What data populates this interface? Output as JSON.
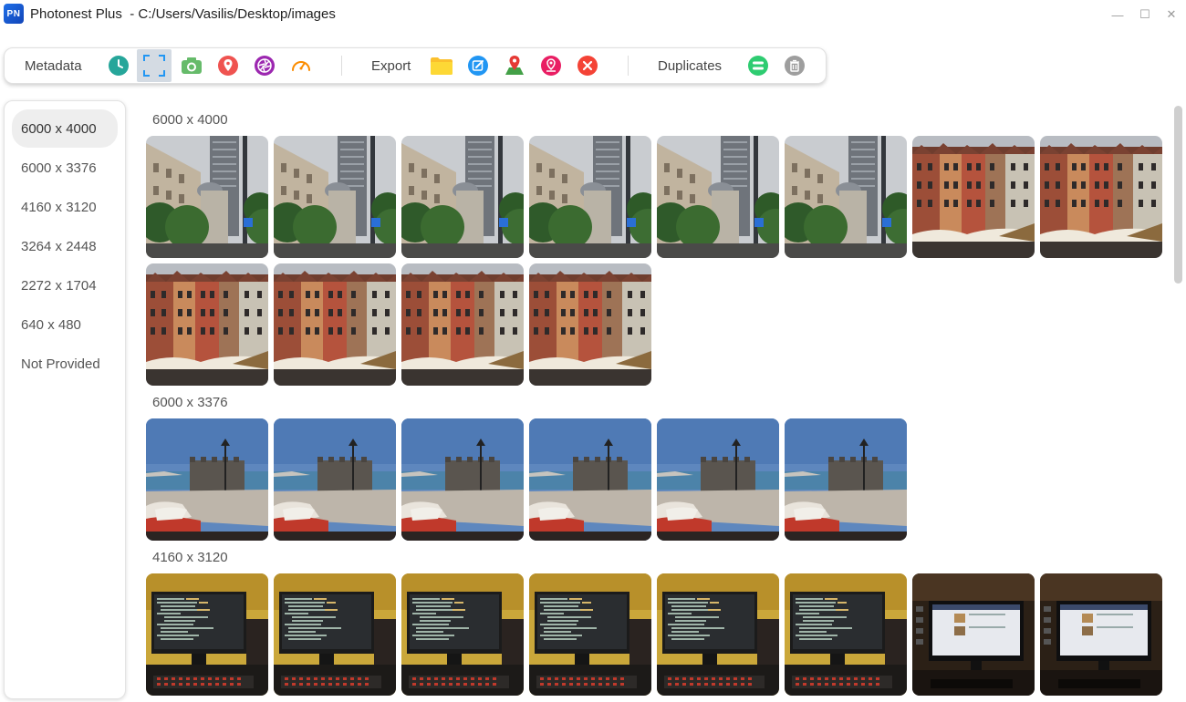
{
  "window": {
    "logo_text": "PN",
    "title": "Photonest Plus  - C:/Users/Vasilis/Desktop/images",
    "minimize": "—",
    "maximize": "☐",
    "close": "✕"
  },
  "toolbar": {
    "metadata_label": "Metadata",
    "export_label": "Export",
    "duplicates_label": "Duplicates"
  },
  "sidebar": {
    "items": [
      {
        "label": "6000 x 4000",
        "selected": true
      },
      {
        "label": "6000 x 3376"
      },
      {
        "label": "4160 x 3120"
      },
      {
        "label": "3264 x 2448"
      },
      {
        "label": "2272 x 1704"
      },
      {
        "label": "640 x 480"
      },
      {
        "label": "Not Provided"
      }
    ]
  },
  "groups": [
    {
      "title": "6000 x 4000",
      "photos": [
        "building",
        "building",
        "building",
        "building",
        "building",
        "building",
        "houses",
        "houses",
        "houses",
        "houses",
        "houses",
        "houses"
      ]
    },
    {
      "title": "6000 x 3376",
      "photos": [
        "harbor",
        "harbor",
        "harbor",
        "harbor",
        "harbor",
        "harbor"
      ]
    },
    {
      "title": "4160 x 3120",
      "photos": [
        "monitor-code",
        "monitor-code",
        "monitor-code",
        "monitor-code",
        "monitor-code",
        "monitor-code",
        "monitor-dark",
        "monitor-dark"
      ]
    }
  ],
  "colors": {
    "history": "#26a69a",
    "camera": "#4caf50",
    "location": "#f44336",
    "aperture": "#9c27b0",
    "speed": "#ff9800",
    "folder": "#fbc02d",
    "edit": "#2196f3",
    "map": "#4caf50",
    "pin": "#e91e63",
    "remove": "#f44336",
    "duplicates": "#2ecc71",
    "trash": "#9e9e9e"
  }
}
